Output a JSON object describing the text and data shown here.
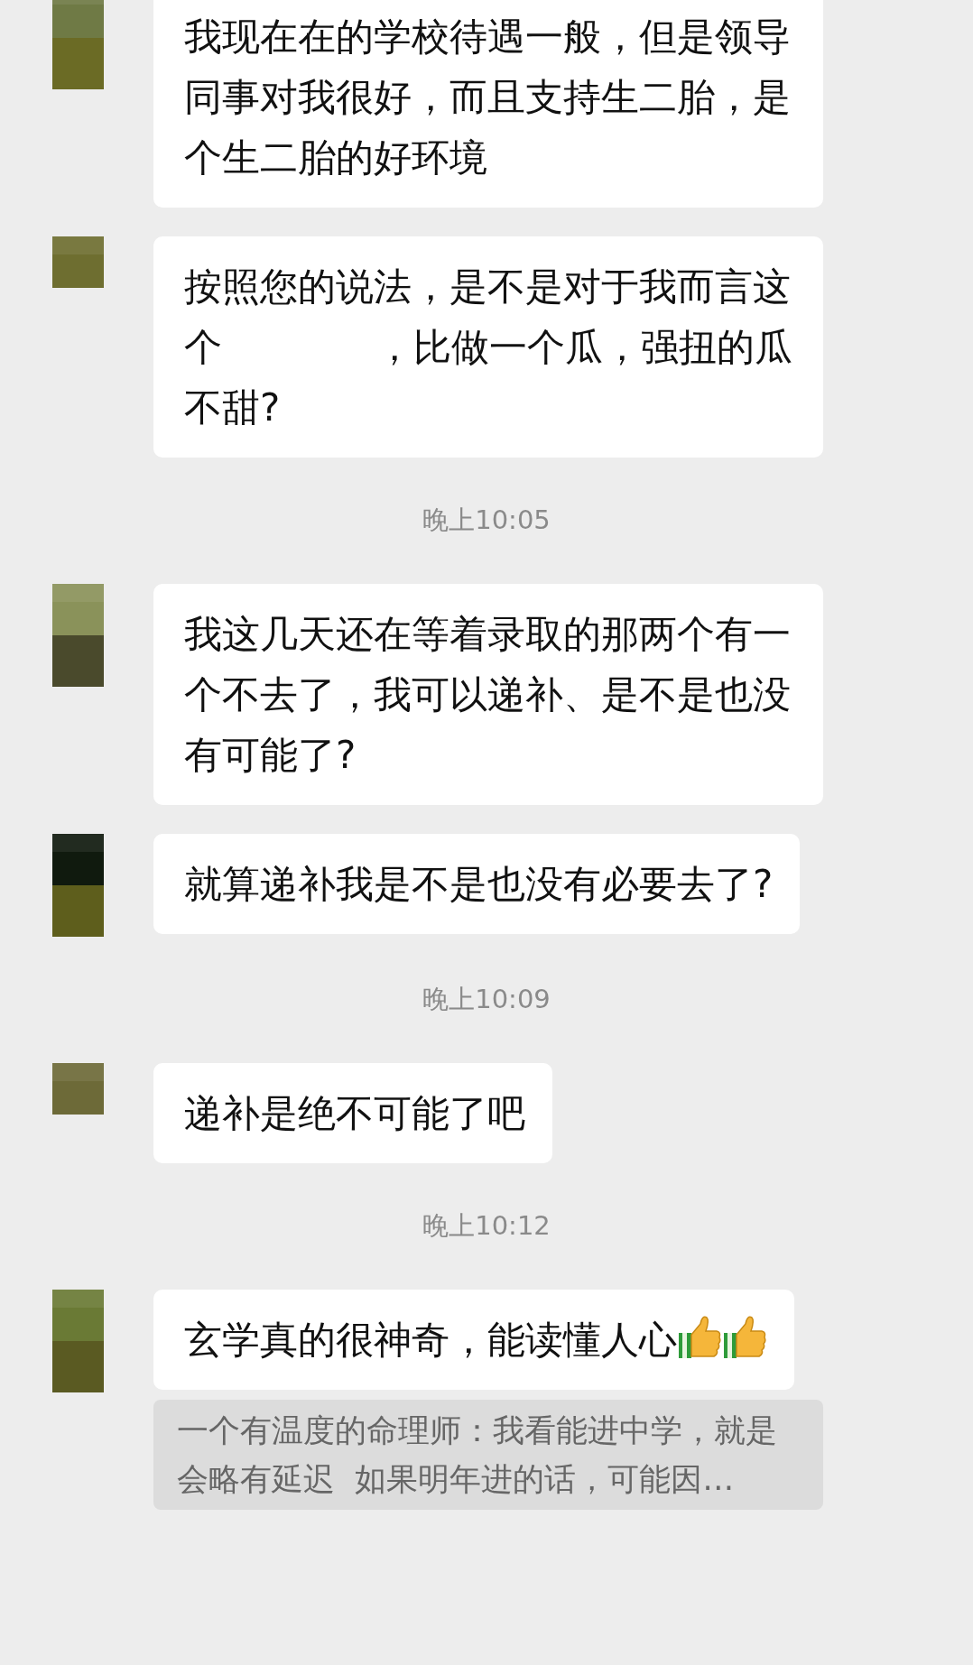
{
  "messages": [
    {
      "kind": "message",
      "parts": [
        "我现在在的学校待遇一般，但是领导同事对我很好，而且支持生二胎，是个生二胎的好环境"
      ]
    },
    {
      "kind": "message",
      "parts": [
        "按照您的说法，是不是对于我而言这个",
        "，比做一个瓜，强扭的瓜不甜?"
      ]
    },
    {
      "kind": "time",
      "text": "晚上10:05"
    },
    {
      "kind": "message",
      "parts": [
        "我这几天还在等着录取的那两个有一个不去了，我可以递补、是不是也没有可能了?"
      ]
    },
    {
      "kind": "message",
      "parts": [
        "就算递补我是不是也没有必要去了?"
      ]
    },
    {
      "kind": "time",
      "text": "晚上10:09"
    },
    {
      "kind": "message",
      "parts": [
        "递补是绝不可能了吧"
      ]
    },
    {
      "kind": "time",
      "text": "晚上10:12"
    },
    {
      "kind": "message",
      "parts": [
        "玄学真的很神奇，能读懂人心"
      ],
      "icons": [
        {
          "kind": "thumbs_up"
        },
        {
          "kind": "thumbs_up"
        }
      ],
      "quote": "一个有温度的命理师：我看能进中学，就是会略有延迟  如果明年进的话，可能因…"
    }
  ]
}
